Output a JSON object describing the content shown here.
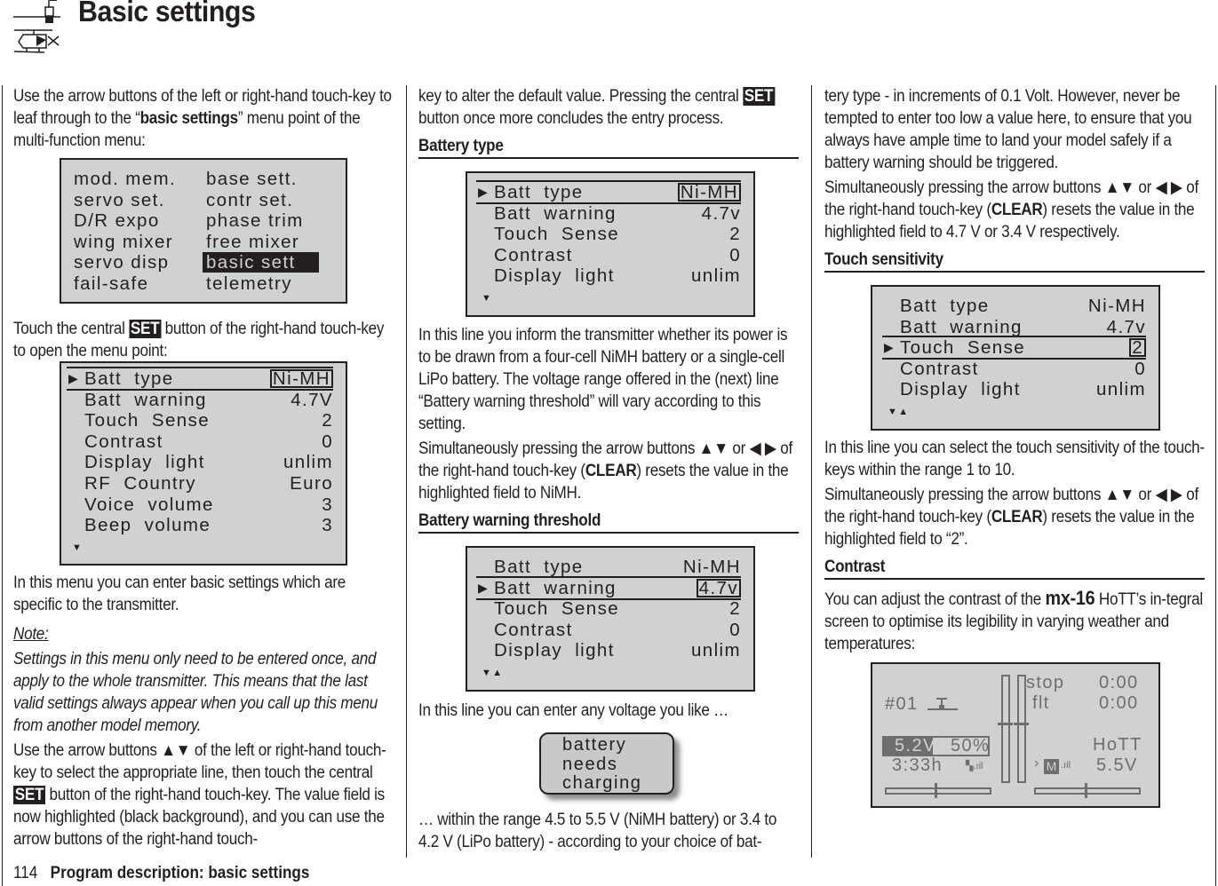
{
  "header": {
    "title": "Basic settings",
    "icons": [
      "airplane-icon",
      "helicopter-icon"
    ]
  },
  "footer": {
    "page_number": "114",
    "section": "Program description: basic settings"
  },
  "col1": {
    "p1_a": "Use the arrow buttons of the left or right-hand touch-key to leaf through to the “",
    "p1_b": "basic settings",
    "p1_c": "” menu point of the multi-function menu:",
    "p2_a": "Touch the central ",
    "p2_set": "SET",
    "p2_b": " button of the right-hand touch-key to open the menu point:",
    "p3": "In this menu you can enter basic settings which are specific to the transmitter.",
    "note_label": "Note:",
    "note_text": "Settings in this menu only need to be entered once, and apply to the whole transmitter. This means that the last valid settings always appear when you call up this menu from another model memory.",
    "p4_a": "Use the arrow buttons ▲▼ of the left or right-hand touch-key to select the appropriate line, then touch the central ",
    "p4_set": "SET",
    "p4_b": " button of the right-hand touch-key. The value field is now highlighted (black background), and you can use the arrow buttons of the right-hand touch-"
  },
  "menu_screen": {
    "left": [
      "mod. mem.",
      "servo set.",
      "D/R expo",
      "wing mixer",
      "servo disp",
      "fail-safe"
    ],
    "right": [
      "base sett.",
      "contr set.",
      "phase trim",
      "free mixer",
      "basic sett",
      "telemetry"
    ],
    "highlighted": "basic sett"
  },
  "full_screen": {
    "rows": [
      {
        "label": "Batt  type",
        "value": "Ni-MH"
      },
      {
        "label": "Batt  warning",
        "value": "4.7V"
      },
      {
        "label": "Touch  Sense",
        "value": "2"
      },
      {
        "label": "Contrast",
        "value": "0"
      },
      {
        "label": "Display  light",
        "value": "unlim"
      },
      {
        "label": "RF  Country",
        "value": "Euro"
      },
      {
        "label": "Voice  volume",
        "value": "3"
      },
      {
        "label": "Beep  volume",
        "value": "3"
      }
    ],
    "selected_row": 0
  },
  "col2": {
    "p1_a": "key to alter the default value. Pressing the central ",
    "p1_set": "SET",
    "p1_b": " button once more concludes the entry process.",
    "h_battery_type": "Battery type",
    "p2": "In this line you inform the transmitter whether its power is to be drawn from a four-cell NiMH battery or a single-cell LiPo battery. The voltage range offered in the (next) line “Battery warning threshold” will vary according to this setting.",
    "p3_a": "Simultaneously pressing the arrow buttons ▲▼ or ◀ ▶ of the right-hand touch-key (",
    "p3_clear": "CLEAR",
    "p3_b": ")  resets the value in the highlighted field to NiMH.",
    "h_battery_warning": "Battery warning threshold",
    "p4": "In this line you can enter any voltage you like …",
    "warning_lines": [
      "battery",
      "needs",
      "charging"
    ],
    "p5": "… within the range 4.5 to 5.5 V (NiMH battery) or 3.4 to 4.2 V (LiPo battery) - according to your choice of bat-"
  },
  "screen_batt_type": {
    "rows": [
      {
        "label": "Batt  type",
        "value": "Ni-MH"
      },
      {
        "label": "Batt  warning",
        "value": "4.7v"
      },
      {
        "label": "Touch  Sense",
        "value": "2"
      },
      {
        "label": "Contrast",
        "value": "0"
      },
      {
        "label": "Display  light",
        "value": "unlim"
      }
    ],
    "selected_row": 0
  },
  "screen_batt_warning": {
    "rows": [
      {
        "label": "Batt  type",
        "value": "Ni-MH"
      },
      {
        "label": "Batt  warning",
        "value": "4.7v"
      },
      {
        "label": "Touch  Sense",
        "value": "2"
      },
      {
        "label": "Contrast",
        "value": "0"
      },
      {
        "label": "Display  light",
        "value": "unlim"
      }
    ],
    "selected_row": 1
  },
  "col3": {
    "p1": "tery type - in increments of 0.1 Volt. However, never be tempted to enter too low a value here, to ensure that you always have ample time to land your model safely if a battery warning should be triggered.",
    "p2_a": "Simultaneously pressing the arrow buttons ▲▼ or ◀ ▶ of the right-hand touch-key (",
    "p2_clear": "CLEAR",
    "p2_b": ") resets the value in the highlighted field to 4.7 V or 3.4 V respectively.",
    "h_touch": "Touch sensitivity",
    "p3": "In this line you can select the touch sensitivity of the touch-keys within the range 1 to 10.",
    "p4_a": "Simultaneously pressing the arrow buttons ▲▼ or ◀ ▶ of the right-hand touch-key (",
    "p4_clear": "CLEAR",
    "p4_b": ") resets the value in the highlighted field to “2”.",
    "h_contrast": "Contrast",
    "p5_a": "You can adjust the contrast of the ",
    "p5_brand": "mx-16",
    "p5_b": " HoTT’s in-tegral screen to optimise its legibility in varying weather and temperatures:"
  },
  "screen_touch": {
    "rows": [
      {
        "label": "Batt  type",
        "value": "Ni-MH"
      },
      {
        "label": "Batt  warning",
        "value": "4.7v"
      },
      {
        "label": "Touch  Sense",
        "value": "2"
      },
      {
        "label": "Contrast",
        "value": "0"
      },
      {
        "label": "Display  light",
        "value": "unlim"
      }
    ],
    "selected_row": 2
  },
  "home_screen": {
    "model": "#01",
    "stop_label": "stop",
    "stop_time": "0:00",
    "flt_label": "flt",
    "flt_time": "0:00",
    "voltage": "5.2V",
    "battery_percent": "50%",
    "runtime": "3:33h",
    "system": "HoTT",
    "rx_voltage": "5.5V",
    "mode_badge": "M"
  }
}
